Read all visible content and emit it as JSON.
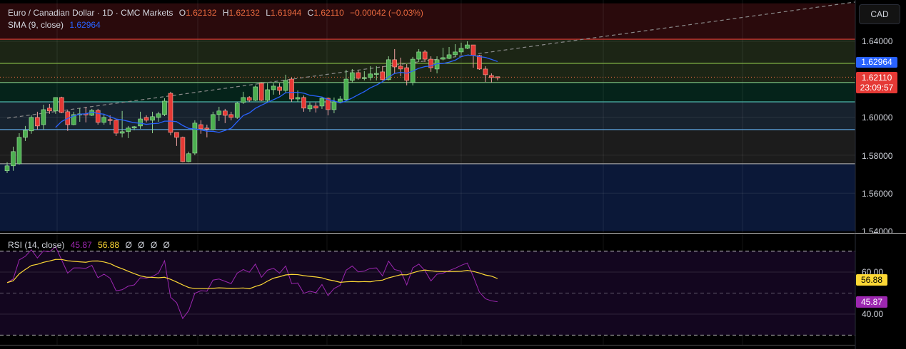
{
  "header": {
    "symbol": "Euro / Canadian Dollar · 1D · CMC Markets",
    "o_label": "O",
    "o": "1.62132",
    "h_label": "H",
    "h": "1.62132",
    "l_label": "L",
    "l": "1.61944",
    "c_label": "C",
    "c": "1.62110",
    "change": "−0.00042 (−0.03%)"
  },
  "sma_legend": {
    "label": "SMA (9, close)",
    "value": "1.62964"
  },
  "rsi_legend": {
    "label": "RSI (14, close)",
    "rsi": "45.87",
    "ma": "56.88",
    "extras": [
      "Ø",
      "Ø",
      "Ø",
      "Ø"
    ]
  },
  "currency_button": "CAD",
  "price_axis": {
    "ticks": [
      "1.64000",
      "1.60000",
      "1.58000",
      "1.56000",
      "1.54000"
    ],
    "sma_tag": "1.62964",
    "price_tag": "1.62110",
    "countdown": "23:09:57"
  },
  "rsi_axis": {
    "ticks": [
      "60.00",
      "40.00"
    ],
    "ma_tag": "56.88",
    "rsi_tag": "45.87"
  },
  "colors": {
    "up": "#4caf50",
    "down": "#e53935",
    "sma": "#2962ff",
    "rsi": "#9c27b0",
    "rsi_ma": "#fdd835",
    "price_tag": "#e53935",
    "sma_tag": "#2962ff"
  },
  "chart_data": [
    {
      "type": "candlestick",
      "interval": "1D",
      "ylim": [
        1.54,
        1.655
      ],
      "yticks": [
        1.54,
        1.56,
        1.58,
        1.6,
        1.64
      ],
      "grid": true,
      "ohlc": [
        [
          1.5718,
          1.5763,
          1.5706,
          1.5744
        ],
        [
          1.5744,
          1.5845,
          1.5718,
          1.5819
        ],
        [
          1.5755,
          1.5916,
          1.575,
          1.5894
        ],
        [
          1.5894,
          1.5954,
          1.5875,
          1.5931
        ],
        [
          1.5928,
          1.601,
          1.5913,
          1.5999
        ],
        [
          1.5999,
          1.6029,
          1.5935,
          1.5954
        ],
        [
          1.5961,
          1.6066,
          1.5935,
          1.604
        ],
        [
          1.6048,
          1.607,
          1.6018,
          1.6033
        ],
        [
          1.6033,
          1.6104,
          1.6018,
          1.6104
        ],
        [
          1.6104,
          1.6108,
          1.6021,
          1.6025
        ],
        [
          1.6029,
          1.6036,
          1.5928,
          1.5961
        ],
        [
          1.5961,
          1.6029,
          1.5958,
          1.6014
        ],
        [
          1.6014,
          1.6048,
          1.5976,
          1.6018
        ],
        [
          1.6018,
          1.6055,
          1.5973,
          1.6014
        ],
        [
          1.601,
          1.6044,
          1.6006,
          1.6036
        ],
        [
          1.6036,
          1.6044,
          1.5961,
          1.5973
        ],
        [
          1.5973,
          1.6018,
          1.5961,
          1.5999
        ],
        [
          1.5988,
          1.601,
          1.5961,
          1.5984
        ],
        [
          1.5984,
          1.5991,
          1.5901,
          1.5916
        ],
        [
          1.5916,
          1.6033,
          1.5894,
          1.5924
        ],
        [
          1.5924,
          1.5954,
          1.589,
          1.5943
        ],
        [
          1.5943,
          1.5954,
          1.5931,
          1.595
        ],
        [
          1.5954,
          1.6029,
          1.5939,
          1.5991
        ],
        [
          1.5999,
          1.601,
          1.5973,
          1.5984
        ],
        [
          1.5984,
          1.6029,
          1.5916,
          1.6003
        ],
        [
          1.5999,
          1.6029,
          1.5976,
          1.6018
        ],
        [
          1.6014,
          1.61,
          1.6006,
          1.6085
        ],
        [
          1.6126,
          1.6134,
          1.5905,
          1.592
        ],
        [
          1.592,
          1.592,
          1.5849,
          1.5894
        ],
        [
          1.5894,
          1.5898,
          1.5763,
          1.5766
        ],
        [
          1.5766,
          1.5819,
          1.5763,
          1.5808
        ],
        [
          1.5811,
          1.5984,
          1.58,
          1.5969
        ],
        [
          1.5961,
          1.5984,
          1.5913,
          1.5939
        ],
        [
          1.5943,
          1.5961,
          1.5894,
          1.5939
        ],
        [
          1.5935,
          1.6029,
          1.5931,
          1.6014
        ],
        [
          1.6014,
          1.6055,
          1.598,
          1.6033
        ],
        [
          1.6033,
          1.6044,
          1.5969,
          1.601
        ],
        [
          1.6014,
          1.6029,
          1.5984,
          1.5999
        ],
        [
          1.5999,
          1.6081,
          1.5991,
          1.6074
        ],
        [
          1.6078,
          1.6134,
          1.607,
          1.6104
        ],
        [
          1.6104,
          1.6111,
          1.6081,
          1.6089
        ],
        [
          1.6089,
          1.6168,
          1.6085,
          1.616
        ],
        [
          1.6179,
          1.6183,
          1.6085,
          1.6089
        ],
        [
          1.6089,
          1.6179,
          1.6081,
          1.6145
        ],
        [
          1.6145,
          1.6179,
          1.6119,
          1.6164
        ],
        [
          1.616,
          1.6179,
          1.6119,
          1.6141
        ],
        [
          1.6141,
          1.6224,
          1.613,
          1.6194
        ],
        [
          1.6201,
          1.6209,
          1.6081,
          1.6096
        ],
        [
          1.6096,
          1.6141,
          1.6081,
          1.6104
        ],
        [
          1.6104,
          1.6115,
          1.6029,
          1.6048
        ],
        [
          1.6044,
          1.6078,
          1.6029,
          1.6063
        ],
        [
          1.6059,
          1.6078,
          1.6025,
          1.6048
        ],
        [
          1.6059,
          1.6108,
          1.6044,
          1.61
        ],
        [
          1.61,
          1.6104,
          1.601,
          1.604
        ],
        [
          1.604,
          1.6104,
          1.6021,
          1.6081
        ],
        [
          1.6078,
          1.6111,
          1.6078,
          1.6096
        ],
        [
          1.6093,
          1.625,
          1.6085,
          1.6201
        ],
        [
          1.6194,
          1.6254,
          1.6183,
          1.6235
        ],
        [
          1.6235,
          1.6246,
          1.6198,
          1.6205
        ],
        [
          1.6205,
          1.6243,
          1.6194,
          1.6209
        ],
        [
          1.6209,
          1.6269,
          1.6194,
          1.6228
        ],
        [
          1.6228,
          1.6269,
          1.6194,
          1.6231
        ],
        [
          1.6239,
          1.6269,
          1.6194,
          1.6198
        ],
        [
          1.6198,
          1.6321,
          1.6194,
          1.6303
        ],
        [
          1.6303,
          1.6359,
          1.6228,
          1.6265
        ],
        [
          1.6269,
          1.6314,
          1.6216,
          1.6254
        ],
        [
          1.6261,
          1.628,
          1.6168,
          1.6194
        ],
        [
          1.6183,
          1.6318,
          1.6168,
          1.6306
        ],
        [
          1.6306,
          1.6359,
          1.6291,
          1.6344
        ],
        [
          1.6344,
          1.6355,
          1.6291,
          1.6306
        ],
        [
          1.6306,
          1.6321,
          1.6239,
          1.6261
        ],
        [
          1.6254,
          1.6321,
          1.6231,
          1.6303
        ],
        [
          1.6306,
          1.6366,
          1.6299,
          1.6314
        ],
        [
          1.631,
          1.637,
          1.6306,
          1.6329
        ],
        [
          1.6329,
          1.6385,
          1.6321,
          1.6344
        ],
        [
          1.6344,
          1.6393,
          1.6329,
          1.6363
        ],
        [
          1.6363,
          1.64,
          1.6359,
          1.6381
        ],
        [
          1.6381,
          1.6381,
          1.6261,
          1.6325
        ],
        [
          1.6325,
          1.6329,
          1.625,
          1.6254
        ],
        [
          1.6254,
          1.6269,
          1.6186,
          1.6224
        ],
        [
          1.622,
          1.6231,
          1.6183,
          1.6209
        ],
        [
          1.62132,
          1.62132,
          1.61944,
          1.6211
        ]
      ],
      "sma_period": 9,
      "levels": [
        {
          "price": 1.6411,
          "color": "#e53935"
        },
        {
          "price": 1.6284,
          "color": "#8bc34a"
        },
        {
          "price": 1.6183,
          "color": "#81c784"
        },
        {
          "price": 1.6081,
          "color": "#4db6ac"
        },
        {
          "price": 1.5935,
          "color": "#64b5f6"
        },
        {
          "price": 1.5755,
          "color": "#9e9e9e"
        }
      ],
      "zones": [
        {
          "from": 1.6411,
          "to": 1.66,
          "color": "#2a0a0c"
        },
        {
          "from": 1.6183,
          "to": 1.6411,
          "color": "#1c2515"
        },
        {
          "from": 1.6081,
          "to": 1.6183,
          "color": "#05231a"
        },
        {
          "from": 1.5935,
          "to": 1.6081,
          "color": "#17222e"
        },
        {
          "from": 1.5755,
          "to": 1.5935,
          "color": "#1c1c1c"
        },
        {
          "from": 1.54,
          "to": 1.5755,
          "color": "#0b1838"
        }
      ],
      "trendline": {
        "from": [
          0,
          1.5995
        ],
        "to": [
          84,
          1.6362
        ],
        "style": "dashed",
        "color": "#8a8a8a"
      },
      "current_price": 1.6211
    },
    {
      "type": "line",
      "title": "RSI (14, close)",
      "ylim": [
        20,
        80
      ],
      "bands": [
        70,
        50,
        30
      ],
      "yticks": [
        40,
        60
      ],
      "rsi": [
        55.0,
        56.7,
        65.8,
        67.5,
        70.6,
        66.7,
        70.1,
        69.7,
        72.0,
        65.8,
        59.5,
        62.0,
        62.0,
        61.8,
        63.2,
        57.3,
        59.0,
        57.1,
        51.1,
        51.6,
        53.3,
        53.9,
        57.3,
        57.1,
        57.9,
        59.5,
        65.4,
        48.0,
        45.4,
        37.9,
        41.7,
        49.9,
        51.1,
        50.9,
        56.2,
        56.7,
        55.6,
        54.5,
        59.5,
        61.2,
        59.9,
        63.8,
        57.5,
        60.9,
        61.8,
        59.5,
        62.9,
        54.5,
        54.8,
        49.9,
        50.9,
        50.2,
        54.1,
        48.8,
        52.2,
        53.7,
        60.9,
        62.9,
        60.1,
        60.5,
        61.8,
        62.0,
        58.2,
        65.2,
        61.2,
        60.5,
        53.9,
        62.0,
        63.8,
        60.7,
        55.8,
        59.0,
        59.5,
        60.7,
        61.8,
        63.2,
        64.3,
        57.9,
        50.5,
        47.3,
        46.3,
        45.87
      ],
      "ma_period": 14
    }
  ]
}
